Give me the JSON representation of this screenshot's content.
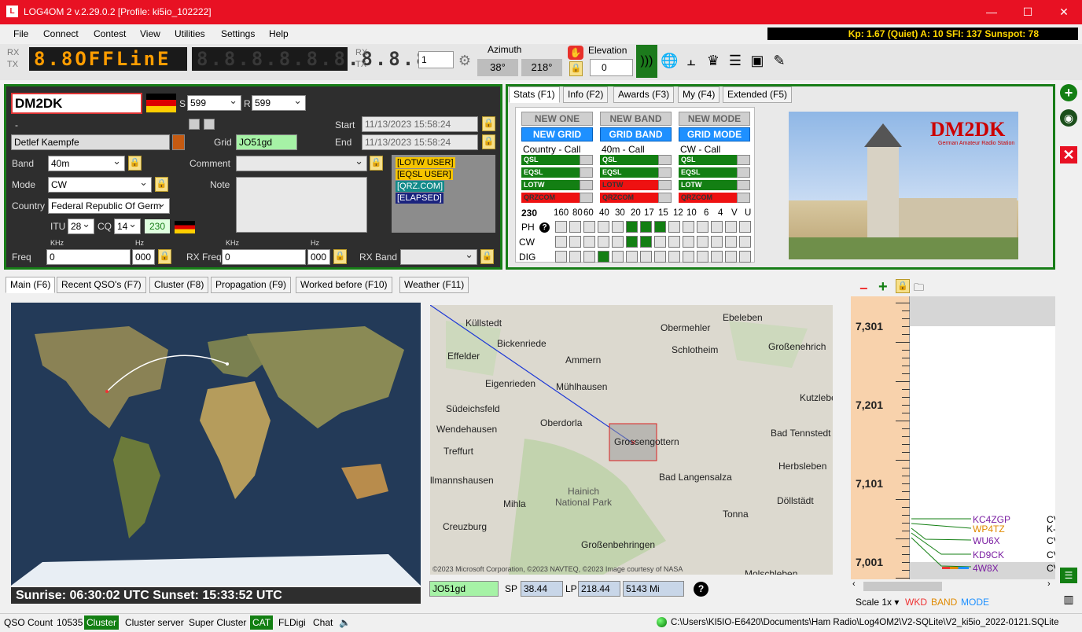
{
  "window": {
    "title": "LOG4OM 2 v.2.29.0.2 [Profile: ki5io_102222]",
    "minimize": "—",
    "maximize": "☐",
    "close": "✕"
  },
  "menu": [
    "File",
    "Connect",
    "Contest",
    "View",
    "Utilities",
    "Settings",
    "Help"
  ],
  "solar": "Kp: 1.67 (Quiet)  A: 10  SFI: 137 Sunspot: 78",
  "toolbar": {
    "rx": "RX",
    "tx": "TX",
    "display": "8.8OFFLinE",
    "display2": "8.8.8.8.8.8.8.8.8",
    "vfo": "1",
    "azimuth_label": "Azimuth",
    "az_sp": "38°",
    "az_lp": "218°",
    "elevation_label": "Elevation",
    "elevation_value": "0"
  },
  "qso": {
    "callsign": "DM2DK",
    "s_label": "S",
    "s_value": "599",
    "r_label": "R",
    "r_value": "599",
    "dash": "-",
    "start_label": "Start",
    "start_value": "11/13/2023 15:58:24",
    "end_label": "End",
    "end_value": "11/13/2023 15:58:24",
    "name": "Detlef Kaempfe",
    "grid_label": "Grid",
    "grid_value": "JO51gd",
    "band_label": "Band",
    "band_value": "40m",
    "comment_label": "Comment",
    "mode_label": "Mode",
    "mode_value": "CW",
    "note_label": "Note",
    "country_label": "Country",
    "country_value": "Federal Republic Of Germ",
    "itu_label": "ITU",
    "itu_value": "28",
    "cq_label": "CQ",
    "cq_value": "14",
    "dxcc": "230",
    "khz_label": "KHz",
    "hz_label": "Hz",
    "freq_label": "Freq",
    "freq_khz": "0",
    "freq_hz": "000",
    "rxfreq_label": "RX Freq",
    "rxfreq_khz": "0",
    "rxfreq_hz": "000",
    "rxband_label": "RX Band",
    "tags": [
      "[LOTW USER]",
      "[EQSL USER]",
      "[QRZ.COM]",
      "[ELAPSED]"
    ]
  },
  "right_tabs": [
    "Stats (F1)",
    "Info (F2)",
    "Awards (F3)",
    "My (F4)",
    "Extended (F5)"
  ],
  "stats": {
    "new_one": "NEW ONE",
    "new_band": "NEW BAND",
    "new_mode": "NEW MODE",
    "new_grid": "NEW GRID",
    "grid_band": "GRID BAND",
    "grid_mode": "GRID MODE",
    "col1": "Country - Call",
    "col2": "40m - Call",
    "col3": "CW - Call",
    "rows1": [
      "QSL",
      "EQSL",
      "LOTW",
      "QRZCOM"
    ],
    "rows2": [
      "QSL",
      "EQSL",
      "LOTW",
      "QRZCOM"
    ],
    "rows3": [
      "QSL",
      "EQSL",
      "LOTW",
      "QRZCOM"
    ],
    "dxcc": "230",
    "bands": [
      "160",
      "80",
      "60",
      "40",
      "30",
      "20",
      "17",
      "15",
      "12",
      "10",
      "6",
      "4",
      "V",
      "U"
    ],
    "modes": [
      "PH",
      "CW",
      "DIG"
    ],
    "help": "?"
  },
  "card": {
    "call": "DM2DK",
    "line1": "German Amateur Radio Station"
  },
  "bottom_tabs": [
    "Main (F6)",
    "Recent QSO's (F7)",
    "Cluster (F8)",
    "Propagation (F9)",
    "Worked before (F10)",
    "Weather (F11)"
  ],
  "sun": "Sunrise: 06:30:02 UTC  Sunset: 15:33:52 UTC",
  "map": {
    "towns": [
      "Küllstedt",
      "Obermehler",
      "Ebeleben",
      "Bickenriede",
      "Schlotheim",
      "Großenehrich",
      "Effelder",
      "Ammern",
      "Eigenrieden",
      "Mühlhausen",
      "Kutzleben",
      "Südeichsfeld",
      "Wendehausen",
      "Oberdorla",
      "Bad Tennstedt",
      "Treffurt",
      "Grossengottern",
      "Herbsleben",
      "llmannshausen",
      "Bad Langensalza",
      "Hainich National Park",
      "Döllstädt",
      "Mihla",
      "Tonna",
      "Creuzburg",
      "Großenbehringen",
      "Molschleben"
    ],
    "credit": "©2023 Microsoft Corporation, ©2023 NAVTEQ, ©2023 Image courtesy of NASA",
    "grid": "JO51gd",
    "sp_label": "SP",
    "sp": "38.44",
    "lp_label": "LP",
    "lp": "218.44",
    "dist": "5143 Mi",
    "help": "?"
  },
  "bandmap": {
    "freqs": [
      "7,301",
      "7,201",
      "7,101",
      "7,001"
    ],
    "spots": [
      {
        "call": "KC4ZGP",
        "mode": "CV",
        "color": "#7b1fa2"
      },
      {
        "call": "WP4TZ",
        "mode": "K-",
        "color": "#e08a00"
      },
      {
        "call": "WU6X",
        "mode": "CV",
        "color": "#7b1fa2"
      },
      {
        "call": "KD9CK",
        "mode": "CV",
        "color": "#7b1fa2"
      },
      {
        "call": "4W8X",
        "mode": "CV",
        "color": "#7b1fa2"
      }
    ],
    "scale": "Scale 1x",
    "wkd": "WKD",
    "band": "BAND",
    "mode": "MODE"
  },
  "status": {
    "qso_label": "QSO Count",
    "qso_count": "10535",
    "cluster": "Cluster",
    "cluster_server": "Cluster server",
    "super_cluster": "Super Cluster",
    "cat": "CAT",
    "fldigi": "FLDigi",
    "chat": "Chat",
    "path": "C:\\Users\\KI5IO-E6420\\Documents\\Ham Radio\\Log4OM2\\V2-SQLite\\V2_ki5io_2022-0121.SQLite"
  }
}
